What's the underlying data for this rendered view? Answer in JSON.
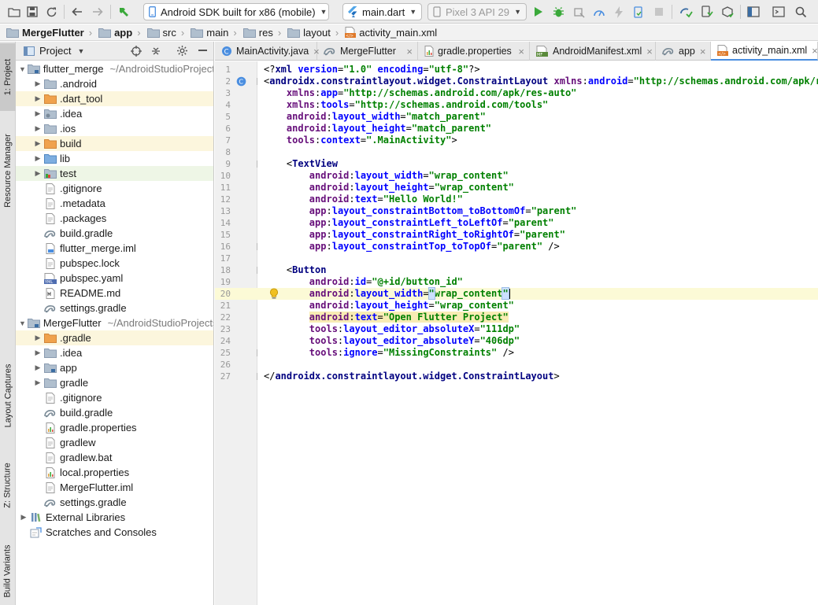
{
  "toolbar": {
    "run_config": "Android SDK built for x86 (mobile)",
    "dart_file": "main.dart",
    "device": "Pixel 3 API 29",
    "colors": {
      "run": "#3aa93a",
      "flutter": "#4fa5e8",
      "accent": "#4a8ee0"
    }
  },
  "breadcrumb": [
    {
      "label": "MergeFlutter",
      "icon": "folder-icon"
    },
    {
      "label": "app",
      "icon": "folder-icon"
    },
    {
      "label": "src",
      "icon": "folder-icon"
    },
    {
      "label": "main",
      "icon": "folder-icon"
    },
    {
      "label": "res",
      "icon": "folder-icon"
    },
    {
      "label": "layout",
      "icon": "folder-icon"
    },
    {
      "label": "activity_main.xml",
      "icon": "xml-file-icon"
    }
  ],
  "left_strip": {
    "project": "1: Project",
    "resource_manager": "Resource Manager",
    "layout_captures": "Layout Captures",
    "structure": "Z: Structure",
    "build_variants": "Build Variants"
  },
  "project_panel": {
    "title": "Project",
    "tree": [
      {
        "label": "flutter_merge",
        "path": "~/AndroidStudioProjects/flutter_merge",
        "indent": 0,
        "arrow": "open",
        "icon": "module-folder-icon",
        "hl": ""
      },
      {
        "label": ".android",
        "indent": 1,
        "arrow": "closed",
        "icon": "folder-icon",
        "hl": ""
      },
      {
        "label": ".dart_tool",
        "indent": 1,
        "arrow": "closed",
        "icon": "orange-folder-icon",
        "hl": "yellow"
      },
      {
        "label": ".idea",
        "indent": 1,
        "arrow": "closed",
        "icon": "settings-folder-icon",
        "hl": ""
      },
      {
        "label": ".ios",
        "indent": 1,
        "arrow": "closed",
        "icon": "folder-icon",
        "hl": ""
      },
      {
        "label": "build",
        "indent": 1,
        "arrow": "closed",
        "icon": "orange-folder-icon",
        "hl": "yellow"
      },
      {
        "label": "lib",
        "indent": 1,
        "arrow": "closed",
        "icon": "source-folder-icon",
        "hl": ""
      },
      {
        "label": "test",
        "indent": 1,
        "arrow": "closed",
        "icon": "test-folder-icon",
        "hl": "green"
      },
      {
        "label": ".gitignore",
        "indent": 1,
        "arrow": "none",
        "icon": "text-file-icon",
        "hl": ""
      },
      {
        "label": ".metadata",
        "indent": 1,
        "arrow": "none",
        "icon": "text-file-icon",
        "hl": ""
      },
      {
        "label": ".packages",
        "indent": 1,
        "arrow": "none",
        "icon": "text-file-icon",
        "hl": ""
      },
      {
        "label": "build.gradle",
        "indent": 1,
        "arrow": "none",
        "icon": "gradle-icon",
        "hl": ""
      },
      {
        "label": "flutter_merge.iml",
        "indent": 1,
        "arrow": "none",
        "icon": "iml-file-icon",
        "hl": ""
      },
      {
        "label": "pubspec.lock",
        "indent": 1,
        "arrow": "none",
        "icon": "text-file-icon",
        "hl": ""
      },
      {
        "label": "pubspec.yaml",
        "indent": 1,
        "arrow": "none",
        "icon": "yaml-file-icon",
        "hl": ""
      },
      {
        "label": "README.md",
        "indent": 1,
        "arrow": "none",
        "icon": "markdown-file-icon",
        "hl": ""
      },
      {
        "label": "settings.gradle",
        "indent": 1,
        "arrow": "none",
        "icon": "gradle-icon",
        "hl": ""
      },
      {
        "label": "MergeFlutter",
        "path": "~/AndroidStudioProjects/MergeFlutter",
        "indent": 0,
        "arrow": "open",
        "icon": "module-folder-icon",
        "hl": ""
      },
      {
        "label": ".gradle",
        "indent": 1,
        "arrow": "closed",
        "icon": "orange-folder-icon",
        "hl": "yellow"
      },
      {
        "label": ".idea",
        "indent": 1,
        "arrow": "closed",
        "icon": "folder-icon",
        "hl": ""
      },
      {
        "label": "app",
        "indent": 1,
        "arrow": "closed",
        "icon": "module-folder-icon",
        "hl": ""
      },
      {
        "label": "gradle",
        "indent": 1,
        "arrow": "closed",
        "icon": "folder-icon",
        "hl": ""
      },
      {
        "label": ".gitignore",
        "indent": 1,
        "arrow": "none",
        "icon": "text-file-icon",
        "hl": ""
      },
      {
        "label": "build.gradle",
        "indent": 1,
        "arrow": "none",
        "icon": "gradle-icon",
        "hl": ""
      },
      {
        "label": "gradle.properties",
        "indent": 1,
        "arrow": "none",
        "icon": "properties-file-icon",
        "hl": ""
      },
      {
        "label": "gradlew",
        "indent": 1,
        "arrow": "none",
        "icon": "text-file-icon",
        "hl": ""
      },
      {
        "label": "gradlew.bat",
        "indent": 1,
        "arrow": "none",
        "icon": "text-file-icon",
        "hl": ""
      },
      {
        "label": "local.properties",
        "indent": 1,
        "arrow": "none",
        "icon": "properties-file-icon",
        "hl": ""
      },
      {
        "label": "MergeFlutter.iml",
        "indent": 1,
        "arrow": "none",
        "icon": "text-file-icon",
        "hl": ""
      },
      {
        "label": "settings.gradle",
        "indent": 1,
        "arrow": "none",
        "icon": "gradle-icon",
        "hl": ""
      },
      {
        "label": "External Libraries",
        "indent": 0,
        "arrow": "closed",
        "icon": "library-icon",
        "hl": ""
      },
      {
        "label": "Scratches and Consoles",
        "indent": 0,
        "arrow": "none",
        "icon": "scratch-icon",
        "hl": ""
      }
    ]
  },
  "editor_tabs": [
    {
      "label": "MainActivity.java",
      "icon": "java-class-icon",
      "active": false
    },
    {
      "label": "MergeFlutter",
      "icon": "gradle-icon",
      "active": false
    },
    {
      "label": "gradle.properties",
      "icon": "properties-file-icon",
      "active": false
    },
    {
      "label": "AndroidManifest.xml",
      "icon": "manifest-file-icon",
      "active": false
    },
    {
      "label": "app",
      "icon": "gradle-icon",
      "active": false
    },
    {
      "label": "activity_main.xml",
      "icon": "xml-file-icon",
      "active": true
    }
  ],
  "editor": {
    "current_line": 20,
    "lines": [
      [
        [
          "plain",
          "<?"
        ],
        [
          "tag",
          "xml "
        ],
        [
          "attr",
          "version"
        ],
        [
          "plain",
          "="
        ],
        [
          "val",
          "\"1.0\" "
        ],
        [
          "attr",
          "encoding"
        ],
        [
          "plain",
          "="
        ],
        [
          "val",
          "\"utf-8\""
        ],
        [
          "plain",
          "?>"
        ]
      ],
      [
        [
          "plain",
          "<"
        ],
        [
          "tag",
          "androidx.constraintlayout.widget.ConstraintLayout "
        ],
        [
          "ns",
          "xmlns"
        ],
        [
          "plain",
          ":"
        ],
        [
          "attr",
          "android"
        ],
        [
          "plain",
          "="
        ],
        [
          "val",
          "\"http://schemas.android.com/apk/res/android\""
        ]
      ],
      [
        [
          "plain",
          "    "
        ],
        [
          "ns",
          "xmlns"
        ],
        [
          "plain",
          ":"
        ],
        [
          "attr",
          "app"
        ],
        [
          "plain",
          "="
        ],
        [
          "val",
          "\"http://schemas.android.com/apk/res-auto\""
        ]
      ],
      [
        [
          "plain",
          "    "
        ],
        [
          "ns",
          "xmlns"
        ],
        [
          "plain",
          ":"
        ],
        [
          "attr",
          "tools"
        ],
        [
          "plain",
          "="
        ],
        [
          "val",
          "\"http://schemas.android.com/tools\""
        ]
      ],
      [
        [
          "plain",
          "    "
        ],
        [
          "ns",
          "android"
        ],
        [
          "plain",
          ":"
        ],
        [
          "attr",
          "layout_width"
        ],
        [
          "plain",
          "="
        ],
        [
          "val",
          "\"match_parent\""
        ]
      ],
      [
        [
          "plain",
          "    "
        ],
        [
          "ns",
          "android"
        ],
        [
          "plain",
          ":"
        ],
        [
          "attr",
          "layout_height"
        ],
        [
          "plain",
          "="
        ],
        [
          "val",
          "\"match_parent\""
        ]
      ],
      [
        [
          "plain",
          "    "
        ],
        [
          "ns",
          "tools"
        ],
        [
          "plain",
          ":"
        ],
        [
          "attr",
          "context"
        ],
        [
          "plain",
          "="
        ],
        [
          "val",
          "\".MainActivity\""
        ],
        [
          "plain",
          ">"
        ]
      ],
      [],
      [
        [
          "plain",
          "    <"
        ],
        [
          "tag",
          "TextView"
        ]
      ],
      [
        [
          "plain",
          "        "
        ],
        [
          "ns",
          "android"
        ],
        [
          "plain",
          ":"
        ],
        [
          "attr",
          "layout_width"
        ],
        [
          "plain",
          "="
        ],
        [
          "val",
          "\"wrap_content\""
        ]
      ],
      [
        [
          "plain",
          "        "
        ],
        [
          "ns",
          "android"
        ],
        [
          "plain",
          ":"
        ],
        [
          "attr",
          "layout_height"
        ],
        [
          "plain",
          "="
        ],
        [
          "val",
          "\"wrap_content\""
        ]
      ],
      [
        [
          "plain",
          "        "
        ],
        [
          "ns",
          "android"
        ],
        [
          "plain",
          ":"
        ],
        [
          "attr",
          "text"
        ],
        [
          "plain",
          "="
        ],
        [
          "val",
          "\"Hello World!\""
        ]
      ],
      [
        [
          "plain",
          "        "
        ],
        [
          "ns",
          "app"
        ],
        [
          "plain",
          ":"
        ],
        [
          "attr",
          "layout_constraintBottom_toBottomOf"
        ],
        [
          "plain",
          "="
        ],
        [
          "val",
          "\"parent\""
        ]
      ],
      [
        [
          "plain",
          "        "
        ],
        [
          "ns",
          "app"
        ],
        [
          "plain",
          ":"
        ],
        [
          "attr",
          "layout_constraintLeft_toLeftOf"
        ],
        [
          "plain",
          "="
        ],
        [
          "val",
          "\"parent\""
        ]
      ],
      [
        [
          "plain",
          "        "
        ],
        [
          "ns",
          "app"
        ],
        [
          "plain",
          ":"
        ],
        [
          "attr",
          "layout_constraintRight_toRightOf"
        ],
        [
          "plain",
          "="
        ],
        [
          "val",
          "\"parent\""
        ]
      ],
      [
        [
          "plain",
          "        "
        ],
        [
          "ns",
          "app"
        ],
        [
          "plain",
          ":"
        ],
        [
          "attr",
          "layout_constraintTop_toTopOf"
        ],
        [
          "plain",
          "="
        ],
        [
          "val",
          "\"parent\""
        ],
        [
          "plain",
          " />"
        ]
      ],
      [],
      [
        [
          "plain",
          "    <"
        ],
        [
          "tag",
          "Button"
        ]
      ],
      [
        [
          "plain",
          "        "
        ],
        [
          "ns",
          "android"
        ],
        [
          "plain",
          ":"
        ],
        [
          "attr",
          "id"
        ],
        [
          "plain",
          "="
        ],
        [
          "val",
          "\"@+id/button_id\""
        ]
      ],
      [
        [
          "plain",
          "        "
        ],
        [
          "ns",
          "android"
        ],
        [
          "plain",
          ":"
        ],
        [
          "attr",
          "layout_width"
        ],
        [
          "plain",
          "="
        ],
        [
          "paren",
          "\""
        ],
        [
          "val",
          "wrap_content"
        ],
        [
          "paren",
          "\""
        ],
        [
          "caret",
          ""
        ]
      ],
      [
        [
          "plain",
          "        "
        ],
        [
          "ns",
          "android"
        ],
        [
          "plain",
          ":"
        ],
        [
          "attr",
          "layout_height"
        ],
        [
          "plain",
          "="
        ],
        [
          "val",
          "\"wrap_content\""
        ]
      ],
      [
        [
          "plain",
          "        "
        ],
        [
          "hlns",
          "android"
        ],
        [
          "hl",
          ":"
        ],
        [
          "hlattr",
          "text"
        ],
        [
          "hl",
          "="
        ],
        [
          "hlval",
          "\"Open Flutter Project\""
        ]
      ],
      [
        [
          "plain",
          "        "
        ],
        [
          "ns",
          "tools"
        ],
        [
          "plain",
          ":"
        ],
        [
          "attr",
          "layout_editor_absoluteX"
        ],
        [
          "plain",
          "="
        ],
        [
          "val",
          "\"111dp\""
        ]
      ],
      [
        [
          "plain",
          "        "
        ],
        [
          "ns",
          "tools"
        ],
        [
          "plain",
          ":"
        ],
        [
          "attr",
          "layout_editor_absoluteY"
        ],
        [
          "plain",
          "="
        ],
        [
          "val",
          "\"406dp\""
        ]
      ],
      [
        [
          "plain",
          "        "
        ],
        [
          "ns",
          "tools"
        ],
        [
          "plain",
          ":"
        ],
        [
          "attr",
          "ignore"
        ],
        [
          "plain",
          "="
        ],
        [
          "val",
          "\"MissingConstraints\""
        ],
        [
          "plain",
          " />"
        ]
      ],
      [],
      [
        [
          "plain",
          "</"
        ],
        [
          "tag",
          "androidx.constraintlayout.widget.ConstraintLayout"
        ],
        [
          "plain",
          ">"
        ]
      ]
    ]
  }
}
